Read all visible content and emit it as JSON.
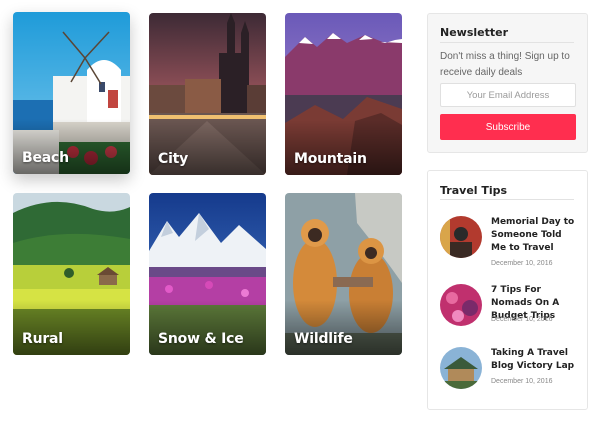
{
  "categories": [
    {
      "label": "Beach"
    },
    {
      "label": "City"
    },
    {
      "label": "Mountain"
    },
    {
      "label": "Rural"
    },
    {
      "label": "Snow & Ice"
    },
    {
      "label": "Wildlife"
    }
  ],
  "newsletter": {
    "title": "Newsletter",
    "text": "Don't miss a thing! Sign up to receive daily deals",
    "email_placeholder": "Your Email Address",
    "button_label": "Subscribe"
  },
  "travel_tips": {
    "title": "Travel Tips",
    "items": [
      {
        "title": "Memorial Day to Someone Told Me to Travel",
        "date": "December 10, 2016"
      },
      {
        "title": "7 Tips For Nomads On A Budget Trips",
        "date": "December 10, 2016"
      },
      {
        "title": "Taking A Travel Blog Victory Lap",
        "date": "December 10, 2016"
      }
    ]
  },
  "colors": {
    "accent": "#ff2e4f"
  }
}
